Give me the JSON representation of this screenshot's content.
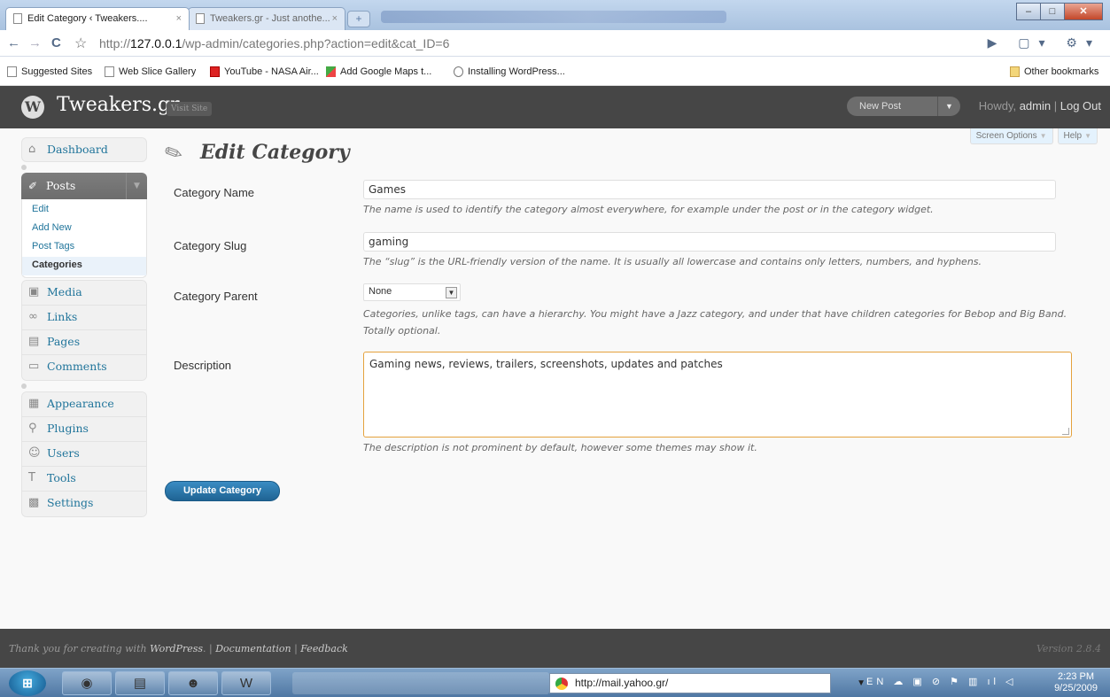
{
  "browser": {
    "tabs": [
      {
        "label": "Edit Category ‹ Tweakers....",
        "active": true
      },
      {
        "label": "Tweakers.gr - Just anothe...",
        "active": false
      }
    ],
    "url_host": "127.0.0.1",
    "url_path": "/wp-admin/categories.php?action=edit&cat_ID=6",
    "bookmarks": [
      {
        "label": "Suggested Sites",
        "icon": "page-icon"
      },
      {
        "label": "Web Slice Gallery",
        "icon": "page-icon"
      },
      {
        "label": "YouTube - NASA Air...",
        "icon": "youtube-icon"
      },
      {
        "label": "Add Google Maps t...",
        "icon": "maps-icon"
      },
      {
        "label": "Installing WordPress...",
        "icon": "wordpress-icon"
      }
    ],
    "other_bookmarks": "Other bookmarks"
  },
  "wp_header": {
    "site_title": "Tweakers.gr",
    "visit_site": "Visit Site",
    "new_post": "New Post",
    "howdy": "Howdy, ",
    "user": "admin",
    "separator": " | ",
    "logout": "Log Out"
  },
  "menu": {
    "dashboard": "Dashboard",
    "posts": "Posts",
    "posts_sub": [
      "Edit",
      "Add New",
      "Post Tags",
      "Categories"
    ],
    "media": "Media",
    "links": "Links",
    "pages": "Pages",
    "comments": "Comments",
    "appearance": "Appearance",
    "plugins": "Plugins",
    "users": "Users",
    "tools": "Tools",
    "settings": "Settings"
  },
  "screen_meta": {
    "screen_options": "Screen Options",
    "help": "Help"
  },
  "page": {
    "title": "Edit Category",
    "name_label": "Category Name",
    "name_value": "Games",
    "name_hint": "The name is used to identify the category almost everywhere, for example under the post or in the category widget.",
    "slug_label": "Category Slug",
    "slug_value": "gaming",
    "slug_hint": "The “slug” is the URL-friendly version of the name. It is usually all lowercase and contains only letters, numbers, and hyphens.",
    "parent_label": "Category Parent",
    "parent_value": "None",
    "parent_hint": "Categories, unlike tags, can have a hierarchy. You might have a Jazz category, and under that have children categories for Bebop and Big Band. Totally optional.",
    "desc_label": "Description",
    "desc_value": "Gaming news, reviews, trailers, screenshots, updates and patches",
    "desc_hint": "The description is not prominent by default, however some themes may show it.",
    "submit": "Update Category"
  },
  "footer": {
    "thanks": "Thank you for creating with ",
    "wordpress": "WordPress",
    "period": ".",
    "sep": " | ",
    "documentation": "Documentation",
    "feedback": "Feedback",
    "version": "Version 2.8.4"
  },
  "taskbar": {
    "address": "http://mail.yahoo.gr/",
    "lang": "EN",
    "time": "2:23 PM",
    "date": "9/25/2009"
  }
}
